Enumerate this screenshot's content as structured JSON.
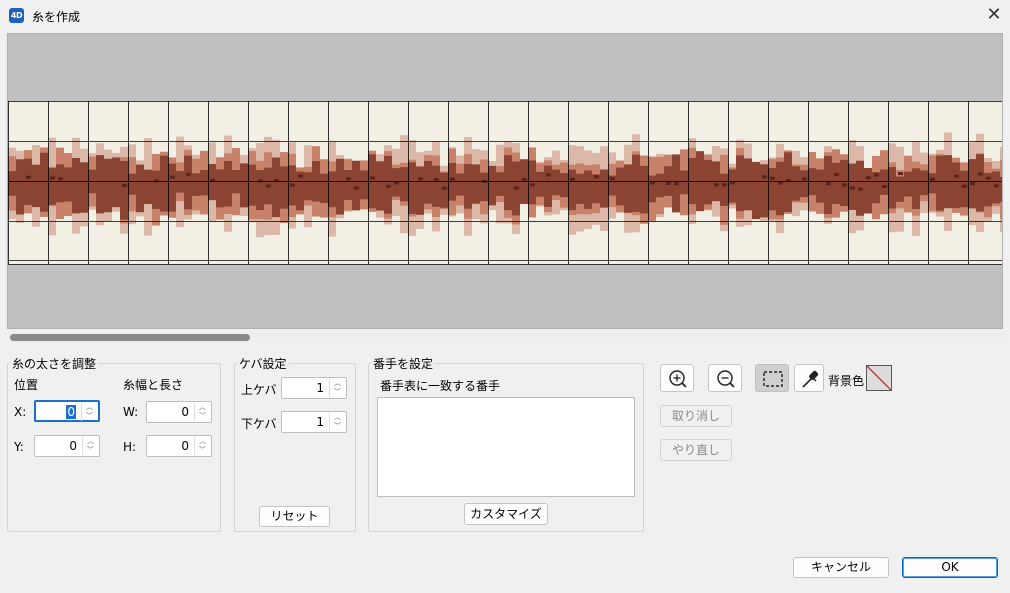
{
  "window": {
    "app_icon_text": "4D",
    "title": "糸を作成"
  },
  "thread_size": {
    "legend": "糸の太さを調整",
    "position_label": "位置",
    "size_label": "糸幅と長さ",
    "x_label": "X:",
    "x_value": "0",
    "y_label": "Y:",
    "y_value": "0",
    "w_label": "W:",
    "w_value": "0",
    "h_label": "H:",
    "h_value": "0"
  },
  "fuzz": {
    "legend": "ケバ設定",
    "upper_label": "上ケバ",
    "upper_value": "1",
    "lower_label": "下ケバ",
    "lower_value": "1",
    "reset_label": "リセット"
  },
  "number": {
    "legend": "番手を設定",
    "match_label": "番手表に一致する番手",
    "customize_label": "カスタマイズ"
  },
  "tools": {
    "zoom_in_icon": "zoom-in-icon",
    "zoom_out_icon": "zoom-out-icon",
    "select_icon": "marquee-select-icon",
    "eyedropper_icon": "eyedropper-icon",
    "background_label": "背景色",
    "undo_label": "取り消し",
    "redo_label": "やり直し"
  },
  "footer": {
    "cancel_label": "キャンセル",
    "ok_label": "OK"
  },
  "colors": {
    "accent": "#1a6fcf",
    "thread_dark": "#8b4332",
    "thread_darker": "#5a2418",
    "thread_mid": "#c9826a",
    "thread_light": "#dcb8a8",
    "canvas_bg": "#f2efe4",
    "margin_gray": "#c0c0c0"
  }
}
